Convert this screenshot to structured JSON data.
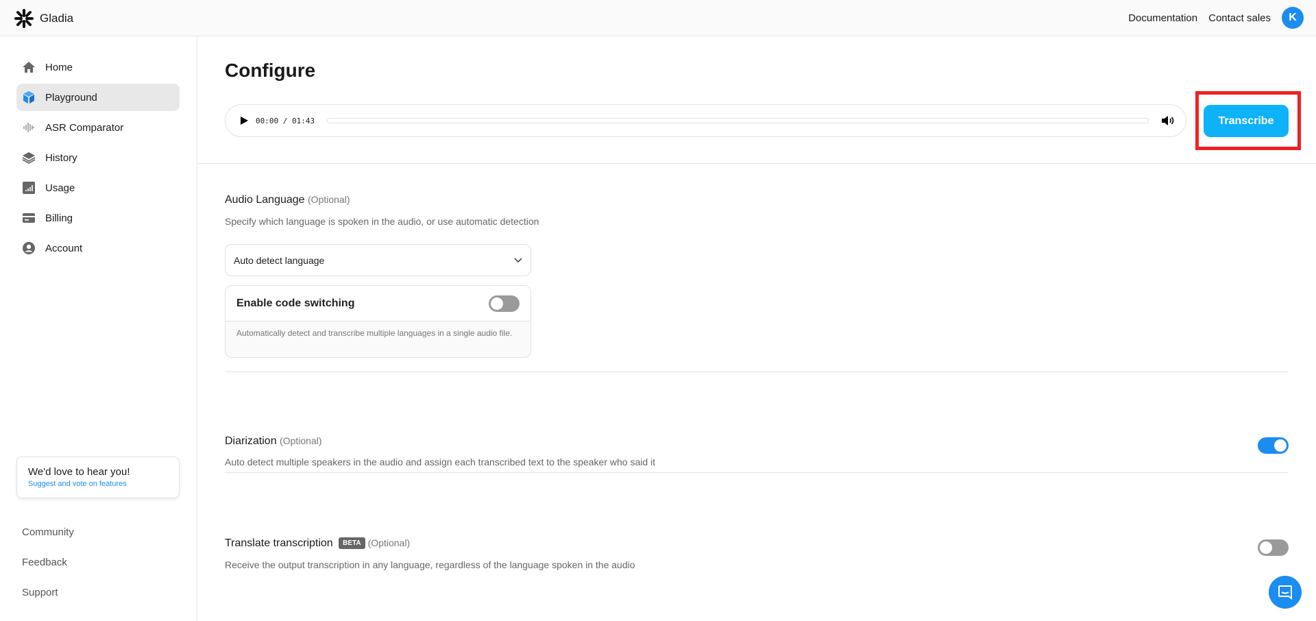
{
  "header": {
    "brand": "Gladia",
    "links": [
      "Documentation",
      "Contact sales"
    ],
    "avatar_initial": "K"
  },
  "sidebar": {
    "items": [
      {
        "label": "Home",
        "icon": "home-icon"
      },
      {
        "label": "Playground",
        "icon": "cube-icon",
        "active": true
      },
      {
        "label": "ASR Comparator",
        "icon": "waveform-icon"
      },
      {
        "label": "History",
        "icon": "layers-icon"
      },
      {
        "label": "Usage",
        "icon": "bar-chart-icon"
      },
      {
        "label": "Billing",
        "icon": "credit-card-icon"
      },
      {
        "label": "Account",
        "icon": "user-circle-icon"
      }
    ],
    "feedback_card": {
      "title": "We'd love to hear you!",
      "link": "Suggest and vote on features"
    },
    "footer": [
      "Community",
      "Feedback",
      "Support"
    ]
  },
  "main": {
    "title": "Configure",
    "player": {
      "current": "00:00",
      "duration": "01:43",
      "separator": "/",
      "progress": 0
    },
    "transcribe_label": "Transcribe",
    "audio_language": {
      "title": "Audio Language",
      "optional": "(Optional)",
      "description": "Specify which language is spoken in the audio, or use automatic detection",
      "select_value": "Auto detect language",
      "code_switching": {
        "title": "Enable code switching",
        "enabled": false,
        "description": "Automatically detect and transcribe multiple languages in a single audio file."
      }
    },
    "diarization": {
      "title": "Diarization",
      "optional": "(Optional)",
      "description": "Auto detect multiple speakers in the audio and assign each transcribed text to the speaker who said it",
      "enabled": true
    },
    "translate": {
      "title": "Translate transcription",
      "badge": "BETA",
      "optional": "(Optional)",
      "description": "Receive the output transcription in any language, regardless of the language spoken in the audio",
      "enabled": false
    }
  },
  "colors": {
    "accent": "#1b8cf0",
    "transcribe": "#0eb2f8",
    "highlight": "#f02020"
  }
}
